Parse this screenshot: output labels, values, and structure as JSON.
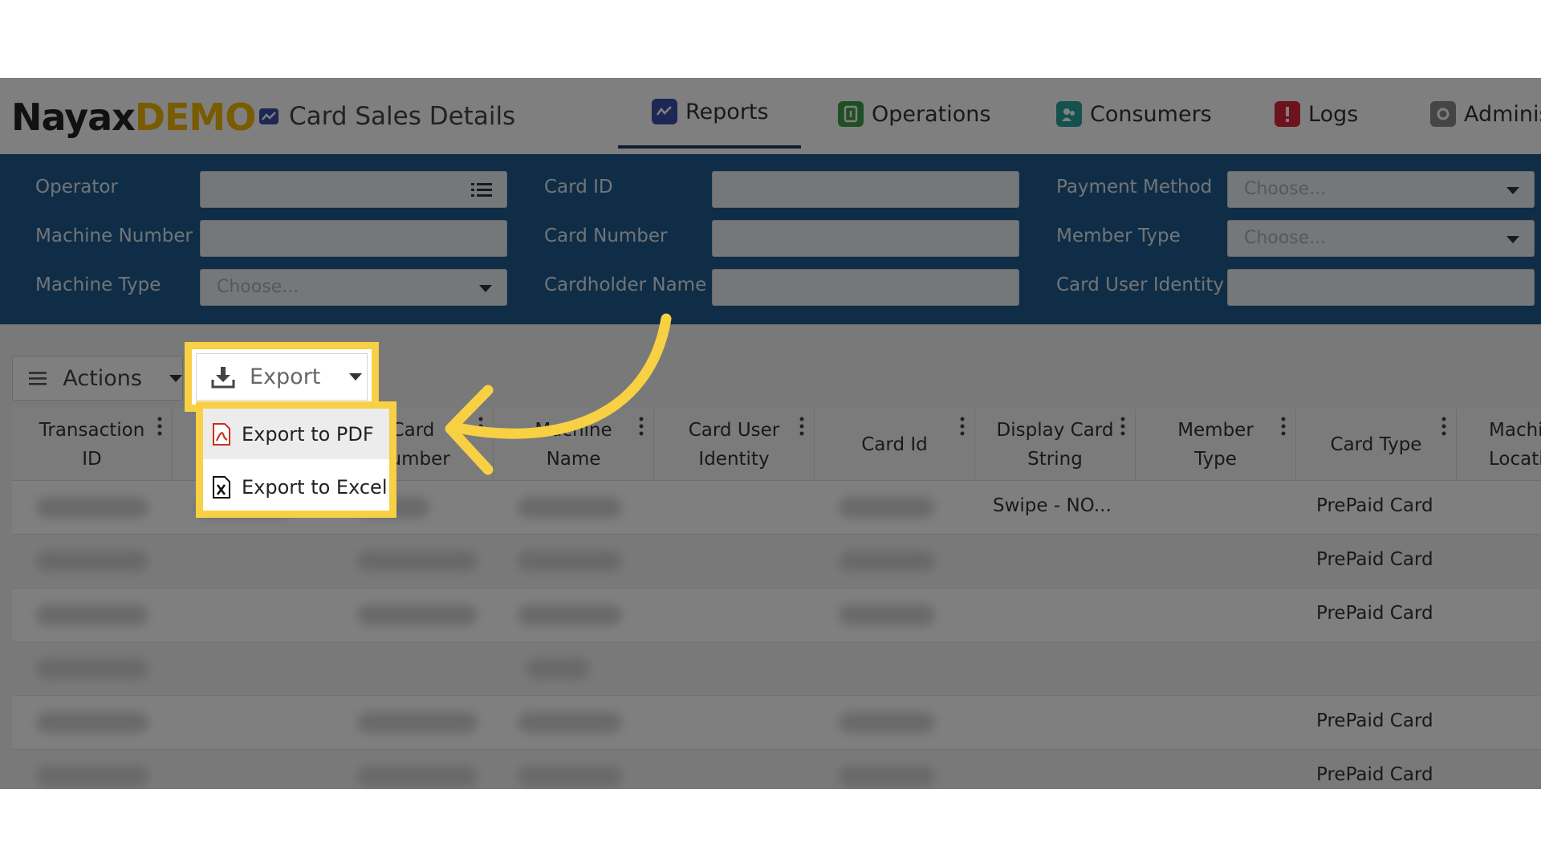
{
  "header": {
    "logo_brand": "Nayax",
    "logo_demo": "DEMO",
    "page_title": "Card Sales Details",
    "nav": [
      {
        "label": "Reports",
        "icon": "chart-line-icon",
        "color": "#3b4ea8",
        "active": true
      },
      {
        "label": "Operations",
        "icon": "operations-icon",
        "color": "#3e9e4a"
      },
      {
        "label": "Consumers",
        "icon": "consumers-icon",
        "color": "#2aa39a"
      },
      {
        "label": "Logs",
        "icon": "alert-icon",
        "color": "#d9263a"
      },
      {
        "label": "Adminis",
        "icon": "admin-icon",
        "color": "#8a8a8a"
      }
    ]
  },
  "filters": {
    "operator": "Operator",
    "machine_number": "Machine Number",
    "machine_type": "Machine Type",
    "machine_type_placeholder": "Choose...",
    "card_id": "Card ID",
    "card_number": "Card Number",
    "cardholder_name": "Cardholder Name",
    "payment_method": "Payment Method",
    "payment_method_placeholder": "Choose...",
    "member_type": "Member Type",
    "member_type_placeholder": "Choose...",
    "card_user_identity": "Card User Identity"
  },
  "toolbar": {
    "actions_label": "Actions",
    "export_label": "Export"
  },
  "export_menu": {
    "pdf_label": "Export to PDF",
    "excel_label": "Export to Excel"
  },
  "table": {
    "columns": [
      {
        "line1": "Transaction",
        "line2": "ID"
      },
      {
        "line1": "",
        "line2": ""
      },
      {
        "line1": "Card",
        "line2": "Number"
      },
      {
        "line1": "Machine",
        "line2": "Name"
      },
      {
        "line1": "Card User",
        "line2": "Identity"
      },
      {
        "line1": "Card Id",
        "line2": ""
      },
      {
        "line1": "Display Card",
        "line2": "String"
      },
      {
        "line1": "Member",
        "line2": "Type"
      },
      {
        "line1": "Card Type",
        "line2": ""
      },
      {
        "line1": "Machi",
        "line2": "Locatio"
      }
    ],
    "rows": [
      {
        "display_card_string": "Swipe - NO...",
        "card_type": "PrePaid Card"
      },
      {
        "display_card_string": "",
        "card_type": "PrePaid Card"
      },
      {
        "display_card_string": "",
        "card_type": "PrePaid Card"
      },
      {
        "display_card_string": "",
        "card_type": ""
      },
      {
        "display_card_string": "",
        "card_type": "PrePaid Card"
      },
      {
        "display_card_string": "",
        "card_type": "PrePaid Card"
      }
    ]
  },
  "colors": {
    "filter_panel": "#1f5a8c",
    "highlight": "#f7d044",
    "demo_accent": "#f2b705"
  }
}
